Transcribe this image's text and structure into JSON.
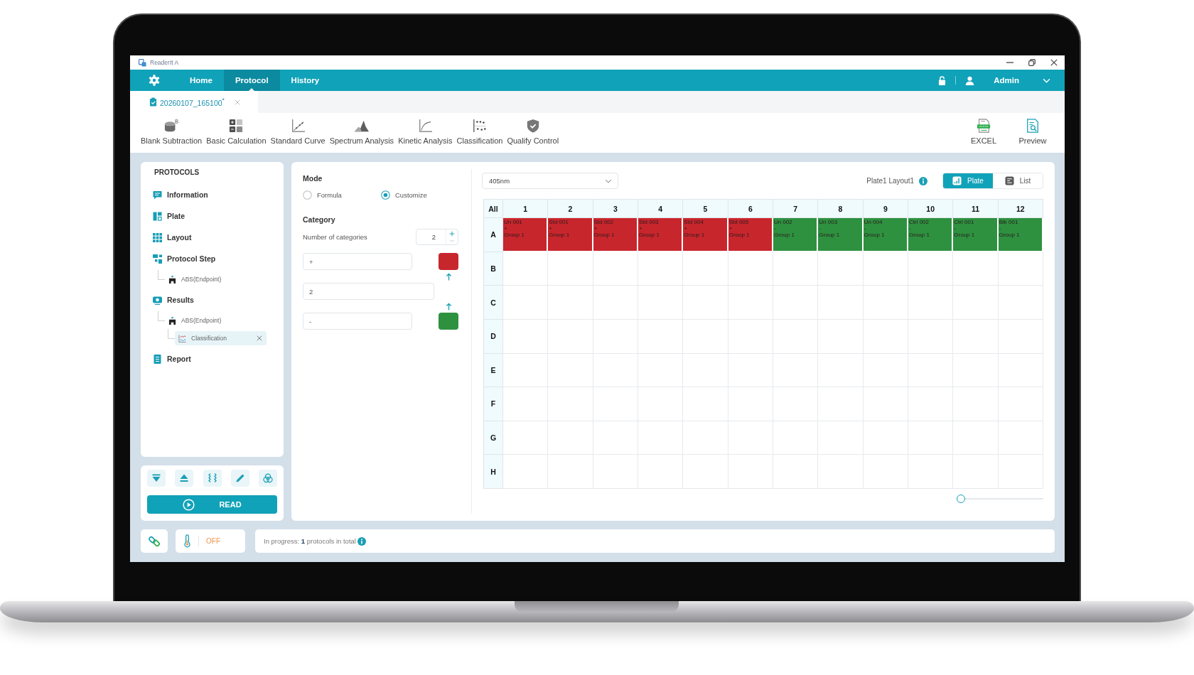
{
  "window": {
    "title": "ReaderIt A"
  },
  "nav": {
    "tabs": [
      {
        "label": "Home",
        "selected": false
      },
      {
        "label": "Protocol",
        "selected": true
      },
      {
        "label": "History",
        "selected": false
      }
    ],
    "user": "Admin"
  },
  "documents": [
    {
      "label": "20260107_165100$^{*}$",
      "selected": true
    }
  ],
  "toolbar": {
    "tools": [
      {
        "label": "Blank Subtraction"
      },
      {
        "label": "Basic Calculation"
      },
      {
        "label": "Standard Curve"
      },
      {
        "label": "Spectrum Analysis"
      },
      {
        "label": "Kinetic Analysis"
      },
      {
        "label": "Classification"
      },
      {
        "label": "Qualify Control"
      }
    ],
    "outputs": [
      {
        "label": "EXCEL"
      },
      {
        "label": "Preview"
      }
    ]
  },
  "sidebar": {
    "title": "PROTOCOLS",
    "items": [
      {
        "label": "Information",
        "selected": false
      },
      {
        "label": "Plate",
        "selected": false
      },
      {
        "label": "Layout",
        "selected": false
      },
      {
        "label": "Protocol Step",
        "selected": false,
        "children": [
          {
            "label": "ABS(Endpoint)",
            "selected": false
          }
        ]
      },
      {
        "label": "Results",
        "selected": false,
        "children": [
          {
            "label": "ABS(Endpoint)",
            "selected": false,
            "children": [
              {
                "label": "Classification",
                "selected": true
              }
            ]
          }
        ]
      },
      {
        "label": "Report",
        "selected": false
      }
    ]
  },
  "run": {
    "label": "READ"
  },
  "classification": {
    "mode": {
      "label": "Mode",
      "options": [
        {
          "label": "Formula",
          "selected": false
        },
        {
          "label": "Customize",
          "selected": true
        }
      ]
    },
    "category": {
      "title": "Category",
      "count_label": "Number of categories",
      "count": "2",
      "rows": [
        {
          "kind": "category",
          "value": "+",
          "color": "#c8262d"
        },
        {
          "kind": "threshold",
          "value": "2"
        },
        {
          "kind": "category",
          "value": "-",
          "color": "#2e9140"
        }
      ]
    }
  },
  "plate": {
    "wavelength": "405nm",
    "layout": "Plate1 Layout1",
    "views": [
      {
        "label": "Plate",
        "selected": true
      },
      {
        "label": "List",
        "selected": false
      }
    ],
    "corner": "All",
    "columns": [
      "1",
      "2",
      "3",
      "4",
      "5",
      "6",
      "7",
      "8",
      "9",
      "10",
      "11",
      "12"
    ],
    "rows": [
      {
        "label": "A",
        "wells": [
          {
            "name": "Un 001",
            "sign": "+",
            "group": "Group 1",
            "color": "#c8262d"
          },
          {
            "name": "Std 001",
            "sign": "+",
            "group": "Group 1",
            "color": "#c8262d"
          },
          {
            "name": "Std 002",
            "sign": "+",
            "group": "Group 1",
            "color": "#c8262d"
          },
          {
            "name": "Std 003",
            "sign": "+",
            "group": "Group 1",
            "color": "#c8262d"
          },
          {
            "name": "Std 004",
            "sign": "+",
            "group": "Group 1",
            "color": "#c8262d"
          },
          {
            "name": "Std 005",
            "sign": "+",
            "group": "Group 1",
            "color": "#c8262d"
          },
          {
            "name": "Un 002",
            "sign": "-",
            "group": "Group 1",
            "color": "#2e9140"
          },
          {
            "name": "Un 003",
            "sign": "-",
            "group": "Group 1",
            "color": "#2e9140"
          },
          {
            "name": "Un 004",
            "sign": "-",
            "group": "Group 1",
            "color": "#2e9140"
          },
          {
            "name": "Ctrl 002",
            "sign": "-",
            "group": "Group 1",
            "color": "#2e9140"
          },
          {
            "name": "Ctrl 001",
            "sign": "-",
            "group": "Group 1",
            "color": "#2e9140"
          },
          {
            "name": "Blk 001",
            "sign": "-",
            "group": "Group 1",
            "color": "#2e9140"
          }
        ]
      },
      {
        "label": "B"
      },
      {
        "label": "C"
      },
      {
        "label": "D"
      },
      {
        "label": "E"
      },
      {
        "label": "F"
      },
      {
        "label": "G"
      },
      {
        "label": "H"
      }
    ],
    "zoom": {
      "level": 0
    }
  },
  "status_bar": {
    "temperature": "OFF",
    "progress": "In progress: **1** protocols in total"
  }
}
